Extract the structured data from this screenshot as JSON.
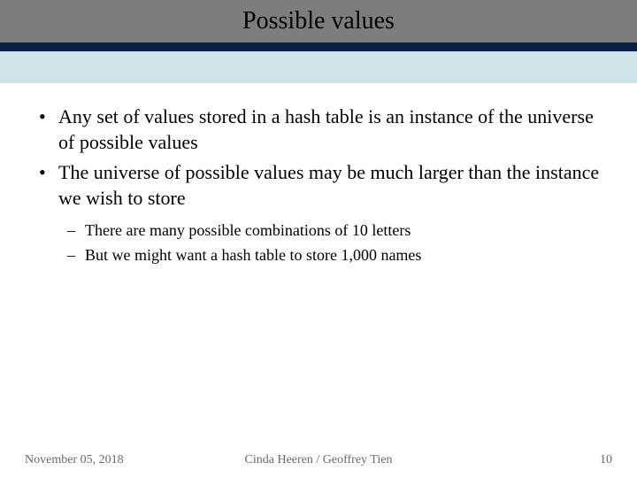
{
  "title": "Possible values",
  "bullets": [
    "Any set of values stored in a hash table is an instance of the universe of possible values",
    "The universe of possible values may be much larger than the instance we wish to store"
  ],
  "subbullets": [
    "There are many possible combinations of 10 letters",
    "But we might want a hash table to store 1,000 names"
  ],
  "footer": {
    "date": "November 05, 2018",
    "author": "Cinda Heeren / Geoffrey Tien",
    "page": "10"
  },
  "colors": {
    "header_gray": "#7d7d7d",
    "band_dark": "#0a1f44",
    "band_light": "#cfe3e8"
  }
}
